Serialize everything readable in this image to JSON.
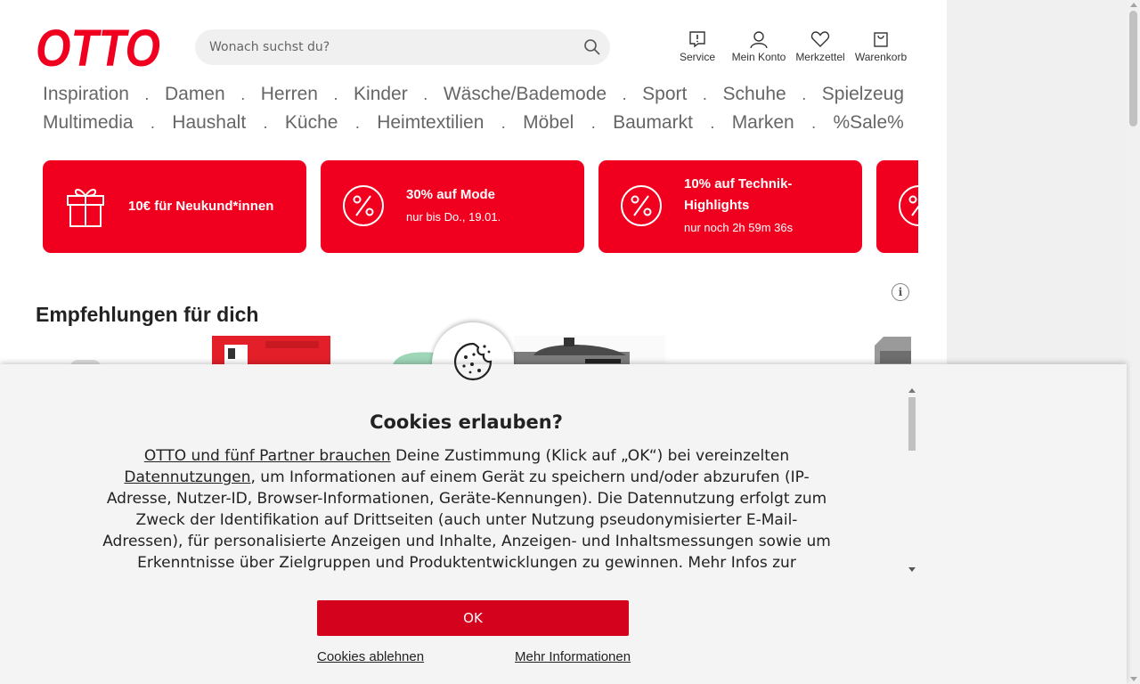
{
  "header": {
    "logo_text": "OTTO",
    "search_placeholder": "Wonach suchst du?",
    "items": [
      {
        "label": "Service",
        "icon": "service-icon"
      },
      {
        "label": "Mein Konto",
        "icon": "user-icon"
      },
      {
        "label": "Merkzettel",
        "icon": "heart-icon"
      },
      {
        "label": "Warenkorb",
        "icon": "cart-icon"
      }
    ]
  },
  "nav": {
    "row1": [
      "Inspiration",
      "Damen",
      "Herren",
      "Kinder",
      "Wäsche/Bademode",
      "Sport",
      "Schuhe",
      "Spielzeug"
    ],
    "row2": [
      "Multimedia",
      "Haushalt",
      "Küche",
      "Heimtextilien",
      "Möbel",
      "Baumarkt",
      "Marken",
      "%Sale%"
    ],
    "separator": "."
  },
  "promos": [
    {
      "icon": "gift-icon",
      "title": "10€ für Neukund*innen",
      "subtitle": ""
    },
    {
      "icon": "percent-icon",
      "title": "30% auf Mode",
      "subtitle": "nur bis Do., 19.01."
    },
    {
      "icon": "percent-icon",
      "title_line1": "10% auf Technik-",
      "title_line2": "Highlights",
      "subtitle": "nur noch 2h 59m 36s"
    }
  ],
  "recommendations": {
    "title": "Empfehlungen für dich",
    "info_icon": "i"
  },
  "cookie_banner": {
    "title": "Cookies erlauben?",
    "text_link1": "OTTO und fünf Partner brauchen",
    "text_part1": " Deine Zustimmung (Klick auf „OK“) bei vereinzelten ",
    "text_link2": "Datennutzungen",
    "text_part2": ", um Informationen auf einem Gerät zu speichern und/oder abzurufen (IP-Adresse, Nutzer-ID, Browser-Informationen, Geräte-Kennungen). Die Datennutzung erfolgt zum Zweck der Identifikation auf Drittseiten (auch unter Nutzung pseudonymisierter E-Mail-Adressen), für personalisierte Anzeigen und Inhalte, Anzeigen- und Inhaltsmessungen sowie um Erkenntnisse über Zielgruppen und Produktentwicklungen zu gewinnen. Mehr Infos zur",
    "ok_label": "OK",
    "decline_label": "Cookies ablehnen",
    "more_label": "Mehr Informationen"
  },
  "colors": {
    "brand_red": "#f0001e",
    "button_red": "#d4021d",
    "overlay_bg": "#f4f4f4"
  }
}
